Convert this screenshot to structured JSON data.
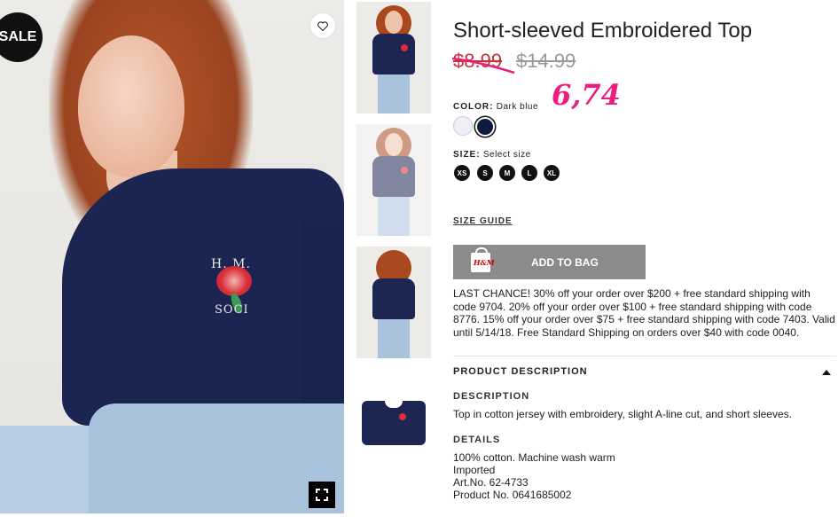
{
  "product": {
    "title": "Short-sleeved Embroidered Top",
    "sale_badge": "SALE",
    "price_sale": "$8.99",
    "price_original": "$14.99",
    "handwritten_price": "6,74",
    "color": {
      "label": "COLOR:",
      "value": "Dark blue",
      "swatches": [
        "#eef0f6",
        "#0f1a3c"
      ]
    },
    "size": {
      "label": "SIZE:",
      "value": "Select size",
      "options": [
        "XS",
        "S",
        "M",
        "L",
        "XL"
      ]
    },
    "size_guide": "SIZE GUIDE",
    "add_to_bag": "ADD TO BAG",
    "bag_logo": "H&M",
    "promo": "LAST CHANCE! 30% off your order over $200 + free standard shipping with code 9704. 20% off your order over $100 + free standard shipping with code 8776. 15% off your order over $75 + free standard shipping with code 7403. Valid until 5/14/18. Free Standard Shipping on orders over $40 with code 0040.",
    "product_description": {
      "heading": "PRODUCT DESCRIPTION",
      "description_heading": "DESCRIPTION",
      "description": "Top in cotton jersey with embroidery, slight A-line cut, and short sleeves.",
      "details_heading": "DETAILS",
      "details": [
        "100% cotton. Machine wash warm",
        "Imported",
        "Art.No. 62-4733",
        "Product No. 0641685002"
      ]
    }
  },
  "image_text": {
    "monogram": "H.  M.",
    "word": "SOCI"
  },
  "icons": {
    "favorite": "heart-icon",
    "expand": "expand-icon",
    "collapse": "caret-up-icon"
  },
  "colors": {
    "accent_sale": "#c4323a",
    "handwritten": "#ec1d7e",
    "add_button": "#8b8b8b"
  }
}
